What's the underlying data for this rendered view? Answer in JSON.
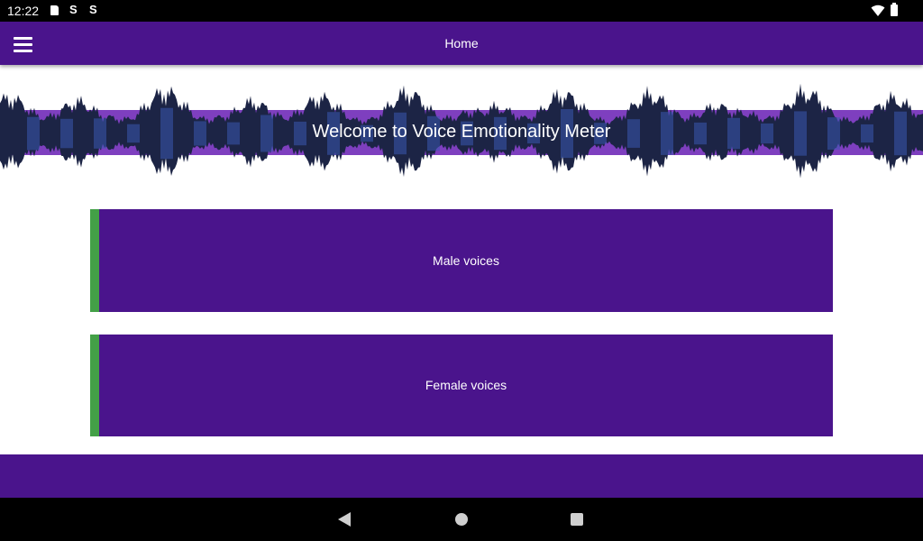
{
  "status_bar": {
    "time": "12:22",
    "icons": [
      "sd-card-icon",
      "s-icon",
      "s-icon",
      "wifi-icon",
      "battery-icon"
    ]
  },
  "app_bar": {
    "title": "Home",
    "menu_icon": "hamburger-menu-icon"
  },
  "banner": {
    "title": "Welcome to Voice Emotionality Meter"
  },
  "buttons": {
    "male_label": "Male voices",
    "female_label": "Female voices"
  },
  "nav_bar": {
    "icons": [
      "back-icon",
      "home-icon",
      "recents-icon"
    ]
  },
  "colors": {
    "primary": "#4a148c",
    "accent": "#43a047",
    "banner_band": "#7e3fbf",
    "waveform": "#1c2445",
    "waveform_highlight": "#3a57b0"
  }
}
